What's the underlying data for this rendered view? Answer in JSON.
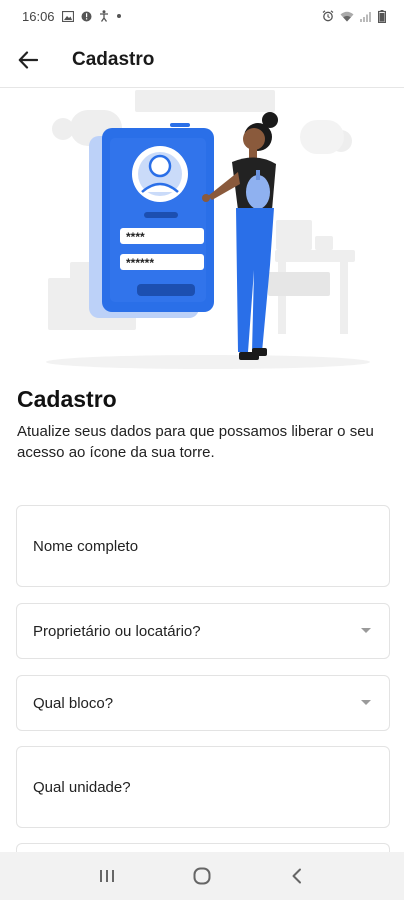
{
  "status_bar": {
    "time": "16:06",
    "left_icons": [
      "image-icon",
      "alert-icon",
      "accessibility-icon",
      "dot-icon"
    ],
    "right_icons": [
      "alarm-icon",
      "wifi-icon",
      "signal-icon",
      "battery-icon"
    ]
  },
  "app_bar": {
    "title": "Cadastro",
    "back_icon": "arrow-left-icon"
  },
  "illustration": {
    "pin_dots": "****",
    "pw_dots": "******",
    "accent_color": "#2a6fe8"
  },
  "form": {
    "heading": "Cadastro",
    "subtitle": "Atualize seus dados para que possamos liberar o seu acesso ao ícone da sua torre.",
    "fields": [
      {
        "label": "Nome completo"
      },
      {
        "label": "Proprietário ou locatário?"
      },
      {
        "label": "Qual bloco?"
      },
      {
        "label": "Qual unidade?"
      },
      {
        "label": ""
      }
    ]
  },
  "nav_bar": {
    "icons": [
      "recent-apps-icon",
      "home-icon",
      "back-icon"
    ]
  }
}
